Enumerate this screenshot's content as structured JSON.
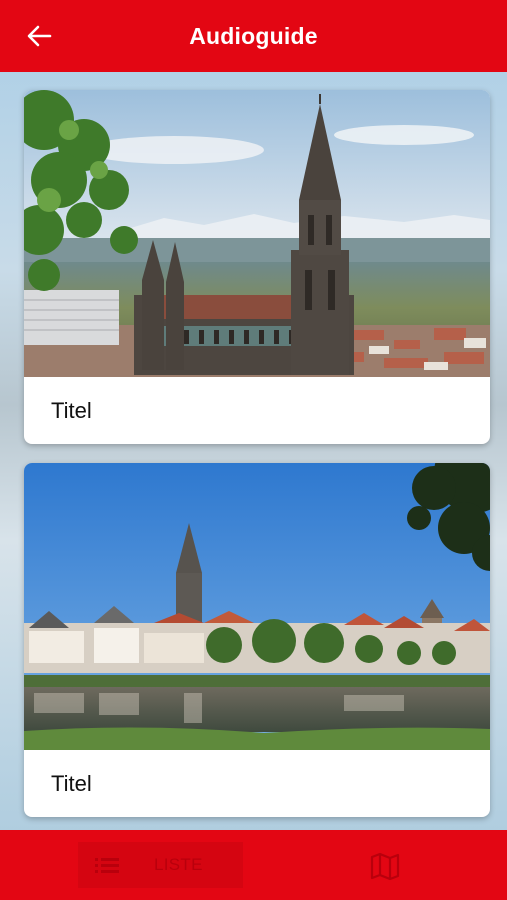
{
  "header": {
    "title": "Audioguide",
    "back_icon": "arrow-left-icon"
  },
  "cards": [
    {
      "caption": "Titel",
      "image": "ulm-minster-panorama"
    },
    {
      "caption": "Titel",
      "image": "ulm-riverside-view"
    }
  ],
  "bottom_nav": {
    "list_label": "LISTE",
    "list_icon": "list-icon",
    "map_icon": "map-icon"
  },
  "colors": {
    "brand_red": "#e30613",
    "tab_text": "#b9000c"
  }
}
